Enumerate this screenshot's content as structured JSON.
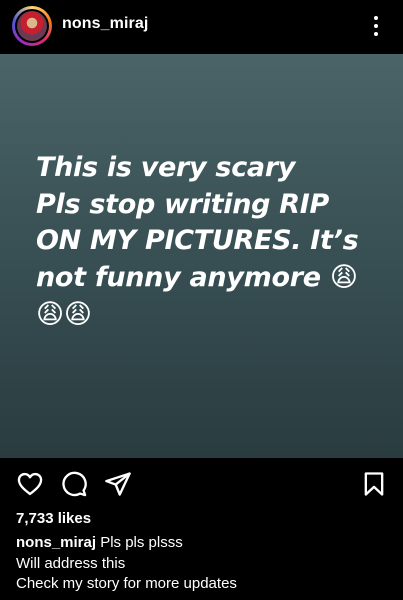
{
  "header": {
    "username": "nons_miraj",
    "avatar_icon": "profile-avatar-with-story-ring",
    "more_icon": "vertical-ellipsis-icon"
  },
  "post": {
    "lines": [
      "This is very scary",
      "Pls stop writing RIP",
      "ON MY PICTURES. It’s",
      "not funny anymore 😩",
      "😩😩"
    ],
    "background_color": "#3f585c"
  },
  "actions": {
    "like_icon": "heart-icon",
    "comment_icon": "comment-bubble-icon",
    "share_icon": "paper-plane-icon",
    "save_icon": "bookmark-icon"
  },
  "likes": "7,733 likes",
  "caption": {
    "username": "nons_miraj",
    "first_line": " Pls pls plsss",
    "lines": [
      "Will address this",
      "Check my story for more updates"
    ]
  }
}
